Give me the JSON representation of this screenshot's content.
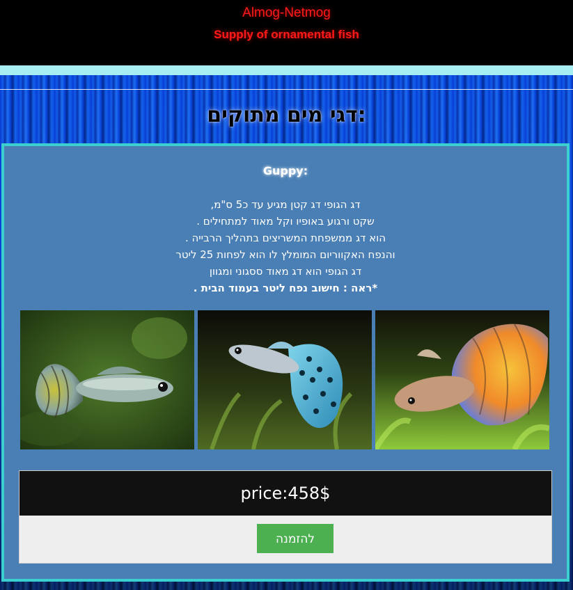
{
  "header": {
    "brand": "Almog-Netmog",
    "tagline": "Supply of ornamental fish"
  },
  "page": {
    "title": "דגי מים מתוקים:"
  },
  "product": {
    "name": "Guppy:",
    "description": [
      "דג הגופי דג קטן מגיע עד כ5 ס\"מ,",
      "שקט ורגוע באופיו וקל מאוד למתחילים .",
      "הוא דג ממשפחת המשריצים בתהליך הרבייה .",
      "והנפח האקווריום המומלץ לו הוא לפחות 25 ליטר",
      "דג הגופי הוא דג מאוד ססגוני ומגוון"
    ],
    "note": "*ראה : חישוב נפח ליטר בעמוד הבית .",
    "price": "price:458$",
    "order_label": "להזמנה"
  },
  "colors": {
    "brand_red": "#ff1a1a",
    "accent_cyan": "#3ccfd0",
    "card_blue": "#4a7fb5",
    "button_green": "#4caf50"
  }
}
